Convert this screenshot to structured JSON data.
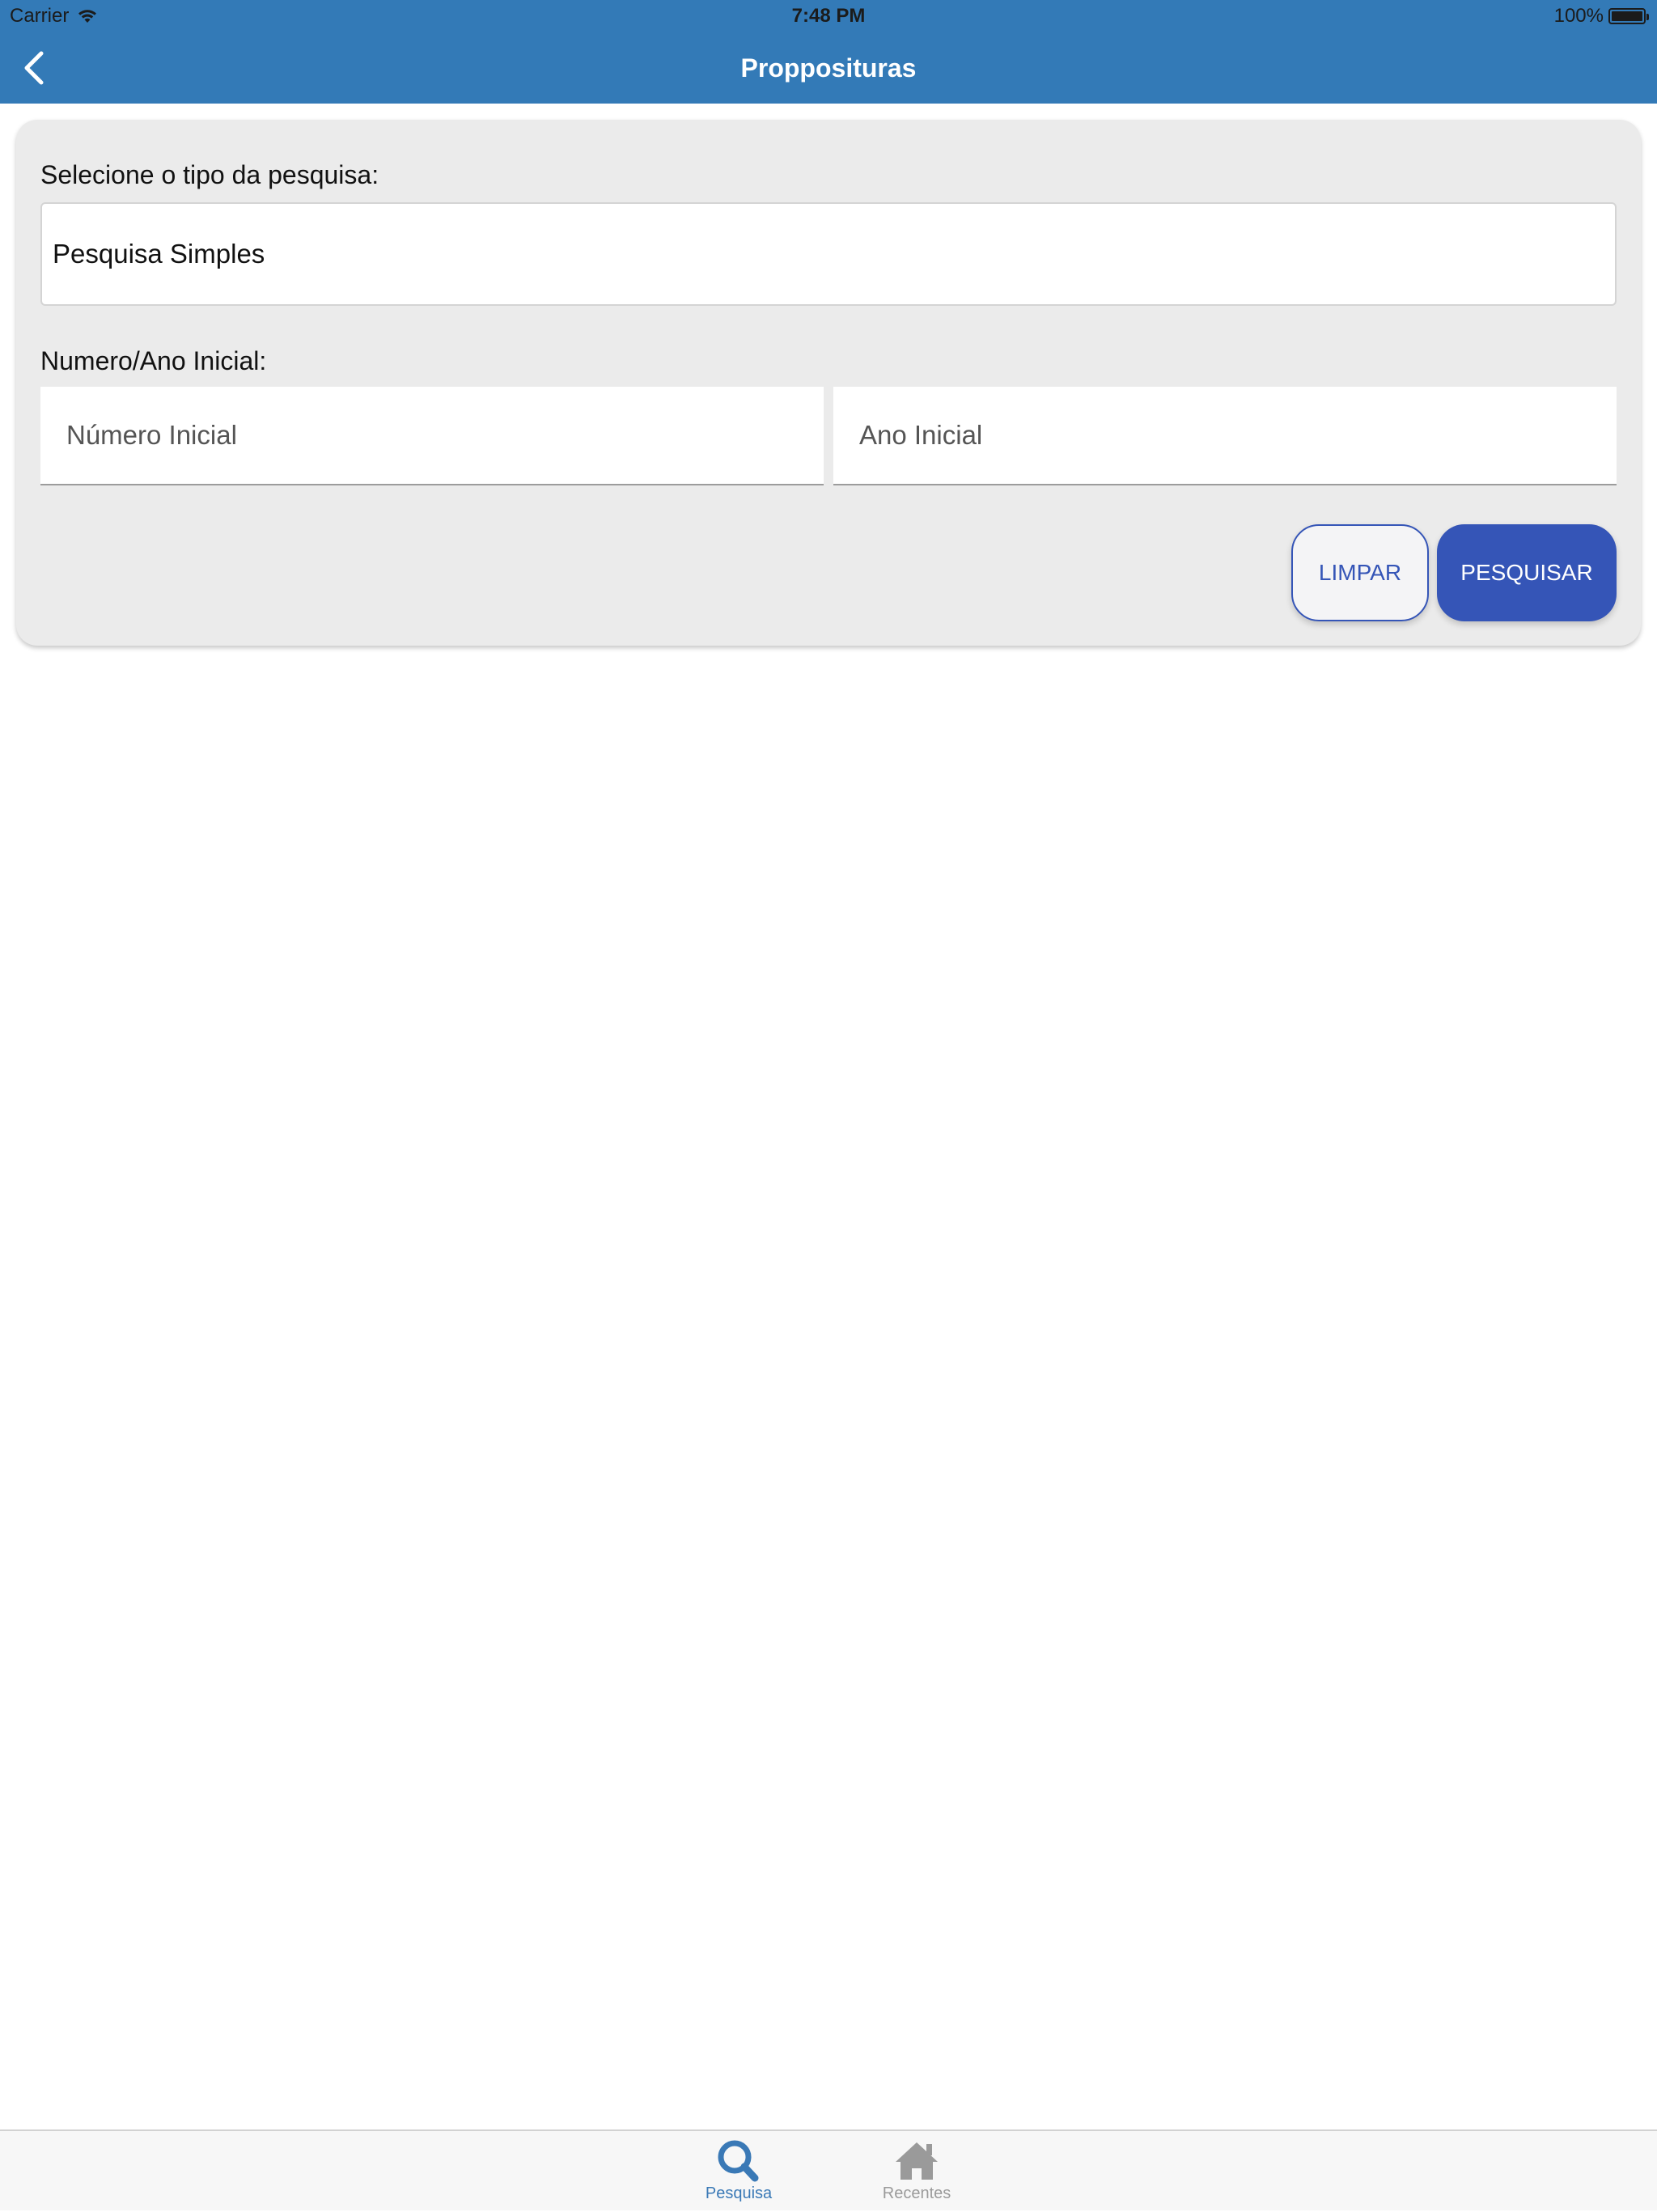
{
  "status_bar": {
    "carrier": "Carrier",
    "time": "7:48 PM",
    "battery": "100%"
  },
  "nav": {
    "title": "Propposituras",
    "back_icon": "chevron-left-icon"
  },
  "form": {
    "search_type_label": "Selecione o tipo da pesquisa:",
    "search_type_value": "Pesquisa Simples",
    "range_label": "Numero/Ano Inicial:",
    "number_placeholder": "Número Inicial",
    "year_placeholder": "Ano Inicial",
    "clear_label": "LIMPAR",
    "search_label": "PESQUISAR"
  },
  "tabs": [
    {
      "label": "Pesquisa",
      "icon": "search-icon",
      "active": true
    },
    {
      "label": "Recentes",
      "icon": "home-icon",
      "active": false
    }
  ],
  "colors": {
    "header": "#337ab7",
    "primary_button": "#3555b7",
    "tab_active": "#3a79b6",
    "tab_inactive": "#9a9a9a"
  }
}
